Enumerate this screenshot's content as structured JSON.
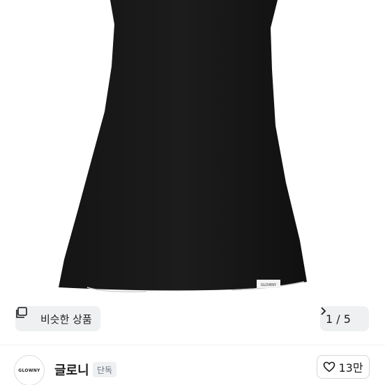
{
  "gallery": {
    "dress_label_text": "GLOWNY",
    "similar_button_label": "비슷한 상품",
    "pager_text": "1 / 5",
    "icons": {
      "similar": "similar-items-icon",
      "next": "chevron-right-icon"
    }
  },
  "seller": {
    "avatar_text": "GLOWNY",
    "name": "글로니",
    "badge": "단독"
  },
  "actions": {
    "like_count": "13만",
    "like_icon": "heart-outline-icon"
  }
}
